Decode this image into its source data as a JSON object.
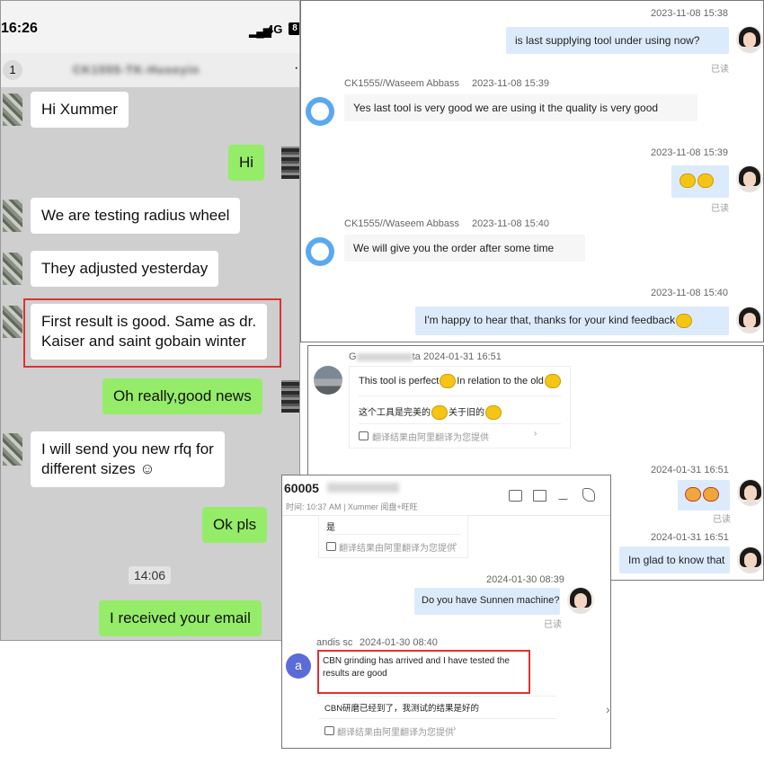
{
  "phone": {
    "status_time": "16:26",
    "network": "4G",
    "battery": "8",
    "signal_glyph": "▂▄▆",
    "back_count": "1",
    "contact_title": "CK1555-TK-Huseyin",
    "more_glyph": "·",
    "time_divider": "14:06",
    "messages": [
      {
        "dir": "in",
        "text": "Hi Xummer"
      },
      {
        "dir": "out",
        "text": "Hi"
      },
      {
        "dir": "in",
        "text": "We are testing radius wheel"
      },
      {
        "dir": "in",
        "text": "They adjusted yesterday"
      },
      {
        "dir": "in",
        "line1": "First result is good. Same as dr.",
        "line2": "Kaiser and saint gobain winter"
      },
      {
        "dir": "out",
        "text": "Oh really,good news"
      },
      {
        "dir": "in",
        "line1": "I will send you new rfq for",
        "line2": "different sizes ☺"
      },
      {
        "dir": "out",
        "text": "Ok pls"
      },
      {
        "dir": "out",
        "text": "I received your email"
      }
    ]
  },
  "panel1": {
    "messages": [
      {
        "time": "2023-11-08 15:38",
        "text": "is last supplying tool under using now?",
        "status": "已读"
      },
      {
        "sender": "CK1555//Waseem Abbass",
        "time": "2023-11-08 15:39",
        "text": "Yes last tool is very good we are using it the quality is very good"
      },
      {
        "time": "2023-11-08 15:39",
        "status": "已读"
      },
      {
        "sender": "CK1555//Waseem Abbass",
        "time": "2023-11-08 15:40",
        "text": "We will give you the order after some time"
      },
      {
        "time": "2023-11-08 15:40",
        "text": "I'm happy to hear that, thanks for your kind feedback"
      }
    ]
  },
  "panel2": {
    "sender": "G",
    "sender_tail": "ta",
    "time": "2024-01-31 16:51",
    "msg_en_a": "This tool is perfect",
    "msg_en_b": "In relation to the old",
    "msg_zh_a": "这个工具是完美的",
    "msg_zh_b": "关于旧的",
    "translate_note": "翻译结果由阿里翻译为您提供",
    "translate_arrow": "›",
    "out_time1": "2024-01-31 16:51",
    "out_status1": "已读",
    "out_time2": "2024-01-31 16:51",
    "out_text2": "Im glad to know that"
  },
  "panel3": {
    "title": "60005",
    "subtitle_time_label": "时间:",
    "subtitle_time": "10:37 AM",
    "subtitle_source": "Xummer 阅盘+旺旺",
    "first_msg": "是",
    "translate_note": "翻译结果由阿里翻译为您提供",
    "translate_arrow": "›",
    "out_time": "2024-01-30 08:39",
    "out_text": "Do you have Sunnen machine?",
    "out_status": "已读",
    "in_avatar_letter": "a",
    "in_sender": "andis sc",
    "in_time": "2024-01-30 08:40",
    "in_line1": "CBN grinding has arrived and I have tested the",
    "in_line2": "results are good",
    "in_zh": "CBN研磨已经到了，我测试的结果是好的",
    "side_arrow": "›"
  },
  "colors": {
    "wechat_green": "#95ec69",
    "desktop_out_bubble": "#dcebfc",
    "highlight_red": "#e03131"
  }
}
